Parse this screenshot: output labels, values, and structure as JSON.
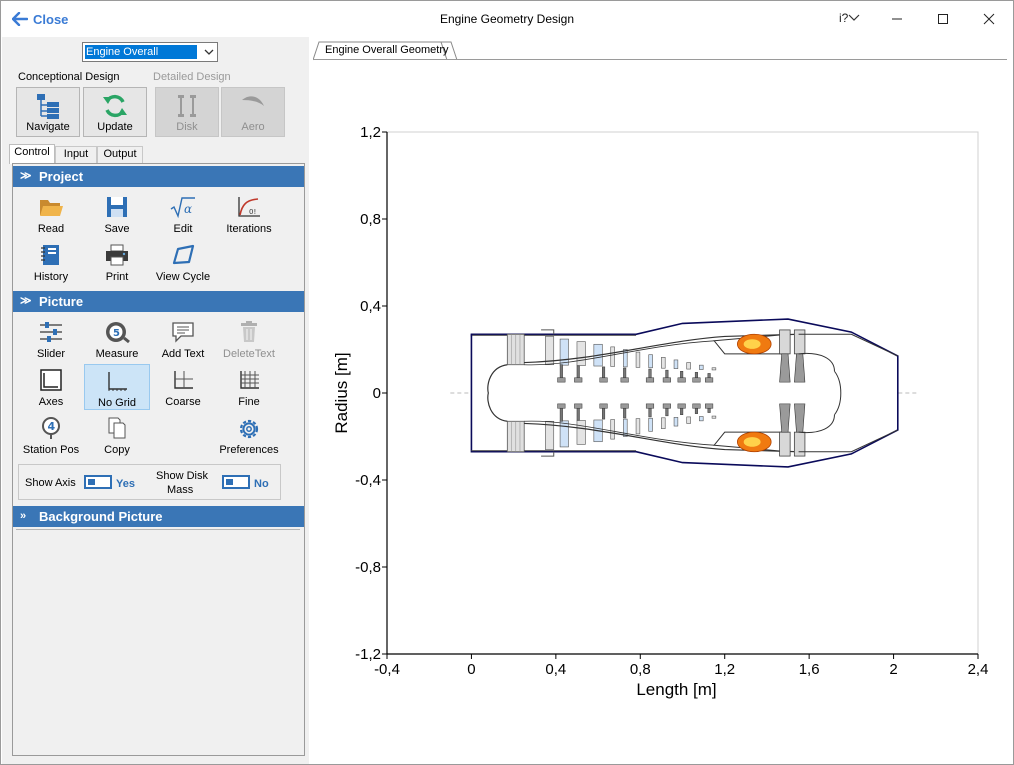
{
  "titlebar": {
    "close_label": "Close",
    "title": "Engine Geometry Design",
    "help_label": "i?"
  },
  "left": {
    "combo_value": "Engine Overall",
    "conceptional_label": "Conceptional Design",
    "detailed_label": "Detailed Design",
    "buttons": {
      "navigate": "Navigate",
      "update": "Update",
      "disk": "Disk",
      "aero": "Aero"
    },
    "tabs": [
      "Control",
      "Input",
      "Output"
    ],
    "sections": {
      "project": "Project",
      "picture": "Picture",
      "background": "Background Picture"
    },
    "project_items": {
      "read": "Read",
      "save": "Save",
      "edit": "Edit",
      "iterations": "Iterations",
      "history": "History",
      "print": "Print",
      "view_cycle": "View Cycle"
    },
    "picture_items": {
      "slider": "Slider",
      "measure": "Measure",
      "add_text": "Add Text",
      "delete_text": "DeleteText",
      "axes": "Axes",
      "no_grid": "No Grid",
      "coarse": "Coarse",
      "fine": "Fine",
      "station_pos": "Station Pos",
      "copy": "Copy",
      "preferences": "Preferences"
    },
    "toggles": {
      "show_axis_label": "Show Axis",
      "show_axis_value": "Yes",
      "show_disk_label_1": "Show Disk",
      "show_disk_label_2": "Mass",
      "show_disk_value": "No"
    }
  },
  "doc_tab": "Engine Overall Geometry",
  "colors": {
    "accent": "#3a76b6",
    "link": "#3a7bd5",
    "engine_outline": "#0a0a5a",
    "flame": "#f07a10"
  },
  "chart_data": {
    "type": "scatter",
    "xlabel": "Length [m]",
    "ylabel": "Radius [m]",
    "xlim": [
      -0.4,
      2.4
    ],
    "ylim": [
      -1.2,
      1.2
    ],
    "x_ticks": [
      "-0,4",
      "0",
      "0,4",
      "0,8",
      "1,2",
      "1,6",
      "2",
      "2,4"
    ],
    "y_ticks": [
      "1,2",
      "0,8",
      "0,4",
      "0",
      "-0,4",
      "-0,8",
      "-1,2"
    ],
    "grid": false,
    "engine": {
      "nacelle_outer": [
        [
          0.0,
          0.27
        ],
        [
          0.78,
          0.27
        ],
        [
          1.0,
          0.32
        ],
        [
          1.5,
          0.34
        ],
        [
          1.8,
          0.28
        ],
        [
          2.02,
          0.17
        ],
        [
          2.02,
          -0.17
        ],
        [
          1.8,
          -0.28
        ],
        [
          1.5,
          -0.34
        ],
        [
          1.0,
          -0.32
        ],
        [
          0.78,
          -0.27
        ],
        [
          0.0,
          -0.27
        ]
      ],
      "spinner": [
        [
          0.08,
          0.0
        ],
        [
          0.1,
          0.09
        ],
        [
          0.17,
          0.13
        ],
        [
          0.17,
          -0.13
        ],
        [
          0.1,
          -0.09
        ]
      ],
      "fan_x": [
        0.17,
        0.25
      ],
      "compressor_stages_x": [
        0.35,
        0.42,
        0.5,
        0.58,
        0.66,
        0.72,
        0.78,
        0.84,
        0.9,
        0.96,
        1.02,
        1.08,
        1.14
      ],
      "combustor_x": [
        1.23,
        1.42
      ],
      "turbine_stages_x": [
        1.46,
        1.53
      ],
      "nozzle_exit_x": 2.12
    }
  }
}
